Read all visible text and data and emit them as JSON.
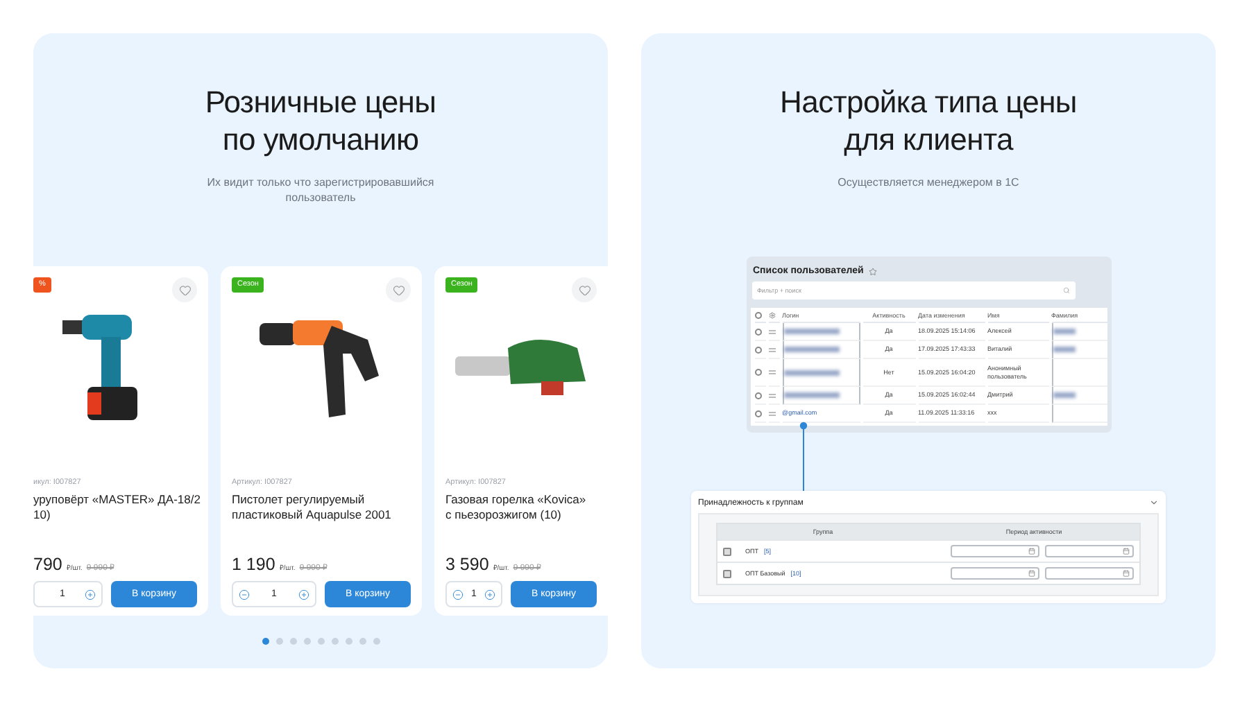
{
  "left": {
    "title_lines": [
      "Розничные цены",
      "по умолчанию"
    ],
    "subtitle_lines": [
      "Их видит только что зарегистрировавшийся",
      "пользователь"
    ],
    "products": [
      {
        "kind": "drill",
        "badge": {
          "text": "%",
          "color": "#f0541e"
        },
        "article": "икул: I007827",
        "name_lines": [
          "уруповёрт «MASTER» ДА-18/2",
          "10)"
        ],
        "price": "790",
        "unit": "₽/шт.",
        "old_price": "9 990 ₽",
        "qty": "1",
        "button": "В корзину"
      },
      {
        "kind": "nozzle",
        "badge": {
          "text": "Сезон",
          "color": "#3bb31f"
        },
        "article": "Артикул: I007827",
        "name_lines": [
          "Пистолет регулируемый",
          "пластиковый Aquapulse 2001"
        ],
        "price": "1 190",
        "unit": "₽/шт.",
        "old_price": "9 990 ₽",
        "qty": "1",
        "button": "В корзину"
      },
      {
        "kind": "torch",
        "badge": {
          "text": "Сезон",
          "color": "#3bb31f"
        },
        "article": "Артикул: I007827",
        "name_lines": [
          "Газовая горелка «Kovica»",
          "с пьезорозжигом (10)"
        ],
        "price": "3 590",
        "unit": "₽/шт.",
        "old_price": "9 990 ₽",
        "qty": "1",
        "button": "В корзину"
      }
    ],
    "dots": [
      {
        "selected": true
      },
      {
        "selected": false
      },
      {
        "selected": false
      },
      {
        "selected": false
      },
      {
        "selected": false
      },
      {
        "selected": false
      },
      {
        "selected": false
      },
      {
        "selected": false
      },
      {
        "selected": false
      }
    ]
  },
  "right": {
    "title_lines": [
      "Настройка типа цены",
      "для клиента"
    ],
    "subtitle": "Осуществляется менеджером в 1С",
    "users": {
      "title": "Список пользователей",
      "search_placeholder": "Фильтр + поиск",
      "all_checked": false,
      "columns": [
        "Логин",
        "Активность",
        "Дата изменения",
        "Имя",
        "Фамилия"
      ],
      "rows": [
        {
          "checked": false,
          "login_blurred": true,
          "active": "Да",
          "date": "18.09.2025 15:14:06",
          "name": "Алексей",
          "surname_blurred": true
        },
        {
          "checked": false,
          "login_blurred": true,
          "active": "Да",
          "date": "17.09.2025 17:43:33",
          "name": "Виталий",
          "surname_blurred": true
        },
        {
          "checked": false,
          "login_blurred": true,
          "active": "Нет",
          "date": "15.09.2025 16:04:20",
          "name": "Анонимный пользователь",
          "surname_blurred": false
        },
        {
          "checked": false,
          "login_blurred": true,
          "active": "Да",
          "date": "15.09.2025 16:02:44",
          "name": "Дмитрий",
          "surname_blurred": true
        },
        {
          "checked": false,
          "login_blurred": false,
          "login": "@gmail.com",
          "active": "Да",
          "date": "11.09.2025 11:33:16",
          "name": "xxx",
          "surname_blurred": false
        }
      ]
    },
    "groups": {
      "title": "Принадлежность к группам",
      "columns": [
        "Группа",
        "Период активности"
      ],
      "rows": [
        {
          "checked": false,
          "name": "ОПТ",
          "count": "[5]"
        },
        {
          "checked": false,
          "name": "ОПТ Базовый",
          "count": "[10]"
        }
      ]
    }
  }
}
